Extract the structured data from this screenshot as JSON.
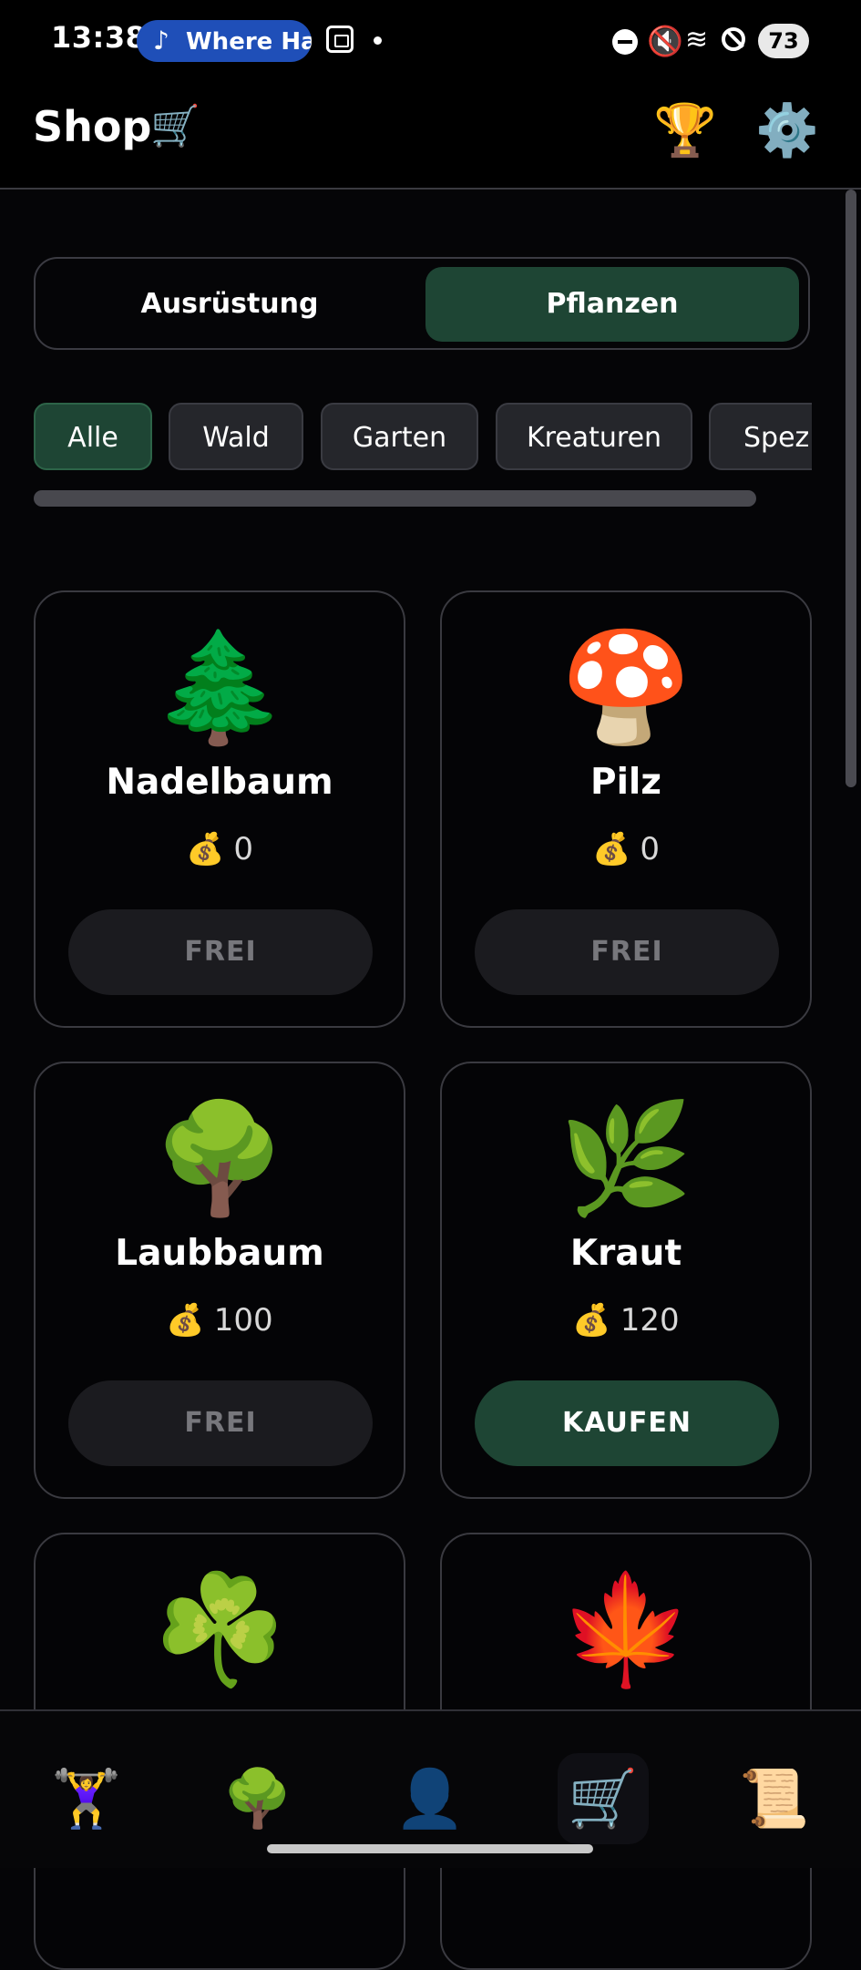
{
  "status_bar": {
    "time": "13:38",
    "media_pill": "Where Ha",
    "battery": "73"
  },
  "header": {
    "title": "Shop",
    "title_icon": "🛒",
    "trophy_icon": "🏆",
    "settings_icon": "⚙️"
  },
  "tabs": [
    {
      "label": "Ausrüstung",
      "active": false
    },
    {
      "label": "Pflanzen",
      "active": true
    }
  ],
  "filters": [
    {
      "label": "Alle",
      "active": true
    },
    {
      "label": "Wald",
      "active": false
    },
    {
      "label": "Garten",
      "active": false
    },
    {
      "label": "Kreaturen",
      "active": false
    },
    {
      "label": "Spezi",
      "active": false
    }
  ],
  "items": [
    {
      "icon": "🌲",
      "name": "Nadelbaum",
      "currency_icon": "💰",
      "price": "0",
      "button": "FREI",
      "button_state": "free"
    },
    {
      "icon": "🍄",
      "name": "Pilz",
      "currency_icon": "💰",
      "price": "0",
      "button": "FREI",
      "button_state": "free"
    },
    {
      "icon": "🌳",
      "name": "Laubbaum",
      "currency_icon": "💰",
      "price": "100",
      "button": "FREI",
      "button_state": "free"
    },
    {
      "icon": "🌿",
      "name": "Kraut",
      "currency_icon": "💰",
      "price": "120",
      "button": "KAUFEN",
      "button_state": "buy"
    },
    {
      "icon": "☘️",
      "name": "",
      "currency_icon": "",
      "price": "",
      "button": "",
      "button_state": "free"
    },
    {
      "icon": "🍁",
      "name": "",
      "currency_icon": "",
      "price": "",
      "button": "",
      "button_state": "free"
    }
  ],
  "bottom_nav": [
    {
      "icon": "🏋️‍♀️",
      "name": "workout-nav-icon",
      "active": false
    },
    {
      "icon": "🌳",
      "name": "tree-nav-icon",
      "active": false
    },
    {
      "icon": "👤",
      "name": "profile-nav-icon",
      "active": false
    },
    {
      "icon": "🛒",
      "name": "shop-nav-icon",
      "active": true
    },
    {
      "icon": "📜",
      "name": "scroll-nav-icon",
      "active": false
    }
  ]
}
